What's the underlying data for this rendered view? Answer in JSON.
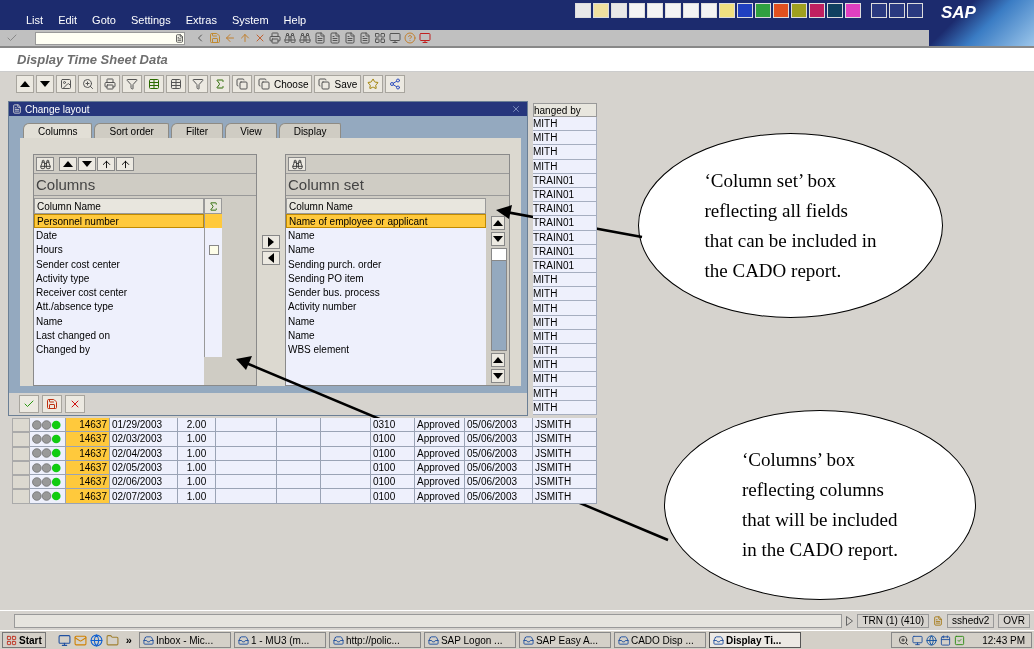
{
  "menu_bar": {
    "items": [
      "List",
      "Edit",
      "Goto",
      "Settings",
      "Extras",
      "System",
      "Help"
    ],
    "logo": "SAP"
  },
  "screen_title": "Display Time Sheet Data",
  "app_toolbar": {
    "buttons": [
      {
        "label": "Choose"
      },
      {
        "label": "Save"
      }
    ]
  },
  "dialog": {
    "title": "Change layout",
    "tabs": [
      {
        "label": "Columns",
        "selected": true
      },
      {
        "label": "Sort order",
        "selected": false
      },
      {
        "label": "Filter",
        "selected": false
      },
      {
        "label": "View",
        "selected": false
      },
      {
        "label": "Display",
        "selected": false
      }
    ],
    "columns": {
      "title": "Columns",
      "header": "Column Name",
      "items": [
        {
          "name": "Personnel number",
          "selected": true
        },
        {
          "name": "Date",
          "selected": false
        },
        {
          "name": "Hours",
          "selected": false,
          "sum": false
        },
        {
          "name": "Sender cost center",
          "selected": false
        },
        {
          "name": "Activity type",
          "selected": false
        },
        {
          "name": "Receiver cost center",
          "selected": false
        },
        {
          "name": "Att./absence type",
          "selected": false
        },
        {
          "name": "Name",
          "selected": false
        },
        {
          "name": "Last changed on",
          "selected": false
        },
        {
          "name": "Changed by",
          "selected": false
        }
      ]
    },
    "column_set": {
      "title": "Column set",
      "header": "Column Name",
      "items": [
        {
          "name": "Name of employee or applicant",
          "selected": true
        },
        {
          "name": "Name",
          "selected": false
        },
        {
          "name": "Name",
          "selected": false
        },
        {
          "name": "Sending purch. order",
          "selected": false
        },
        {
          "name": "Sending PO item",
          "selected": false
        },
        {
          "name": "Sender bus. process",
          "selected": false
        },
        {
          "name": "Activity number",
          "selected": false
        },
        {
          "name": "Name",
          "selected": false
        },
        {
          "name": "Name",
          "selected": false
        },
        {
          "name": "WBS element",
          "selected": false
        }
      ]
    }
  },
  "table": {
    "changed_by_header": "hanged by",
    "changed_by_cells": [
      "MITH",
      "MITH",
      "MITH",
      "MITH",
      "TRAIN01",
      "TRAIN01",
      "TRAIN01",
      "TRAIN01",
      "TRAIN01",
      "TRAIN01",
      "TRAIN01",
      "MITH",
      "MITH",
      "MITH",
      "MITH",
      "MITH",
      "MITH",
      "MITH",
      "MITH",
      "MITH",
      "MITH"
    ],
    "rows": [
      {
        "color": "#11cc11",
        "personnel": "14637",
        "date": "01/29/2003",
        "hours": "2.00",
        "code": "0310",
        "status": "Approved",
        "changed_on": "05/06/2003",
        "changed_by": "JSMITH"
      },
      {
        "color": "#11cc11",
        "personnel": "14637",
        "date": "02/03/2003",
        "hours": "1.00",
        "code": "0100",
        "status": "Approved",
        "changed_on": "05/06/2003",
        "changed_by": "JSMITH"
      },
      {
        "color": "#11cc11",
        "personnel": "14637",
        "date": "02/04/2003",
        "hours": "1.00",
        "code": "0100",
        "status": "Approved",
        "changed_on": "05/06/2003",
        "changed_by": "JSMITH"
      },
      {
        "color": "#11cc11",
        "personnel": "14637",
        "date": "02/05/2003",
        "hours": "1.00",
        "code": "0100",
        "status": "Approved",
        "changed_on": "05/06/2003",
        "changed_by": "JSMITH"
      },
      {
        "color": "#11cc11",
        "personnel": "14637",
        "date": "02/06/2003",
        "hours": "1.00",
        "code": "0100",
        "status": "Approved",
        "changed_on": "05/06/2003",
        "changed_by": "JSMITH"
      },
      {
        "color": "#11cc11",
        "personnel": "14637",
        "date": "02/07/2003",
        "hours": "1.00",
        "code": "0100",
        "status": "Approved",
        "changed_on": "05/06/2003",
        "changed_by": "JSMITH"
      }
    ]
  },
  "callouts": [
    {
      "text": "‘Column set’ box\nreflecting all fields\nthat can be included in\nthe CADO report."
    },
    {
      "text": "‘Columns’ box\nreflecting columns\nthat will be included\nin the CADO report."
    }
  ],
  "status_bar": {
    "items": [
      "TRN (1) (410)",
      "sshedv2",
      "OVR"
    ]
  },
  "taskbar": {
    "start": "Start",
    "more": "»",
    "tasks": [
      {
        "label": "Inbox - Mic...",
        "selected": false
      },
      {
        "label": "1 - MU3 (m...",
        "selected": false
      },
      {
        "label": "http://polic...",
        "selected": false
      },
      {
        "label": "SAP Logon ...",
        "selected": false
      },
      {
        "label": "SAP Easy A...",
        "selected": false
      },
      {
        "label": "CADO Disp ...",
        "selected": false
      },
      {
        "label": "Display Ti...",
        "selected": true
      }
    ],
    "clock": "12:43 PM"
  }
}
